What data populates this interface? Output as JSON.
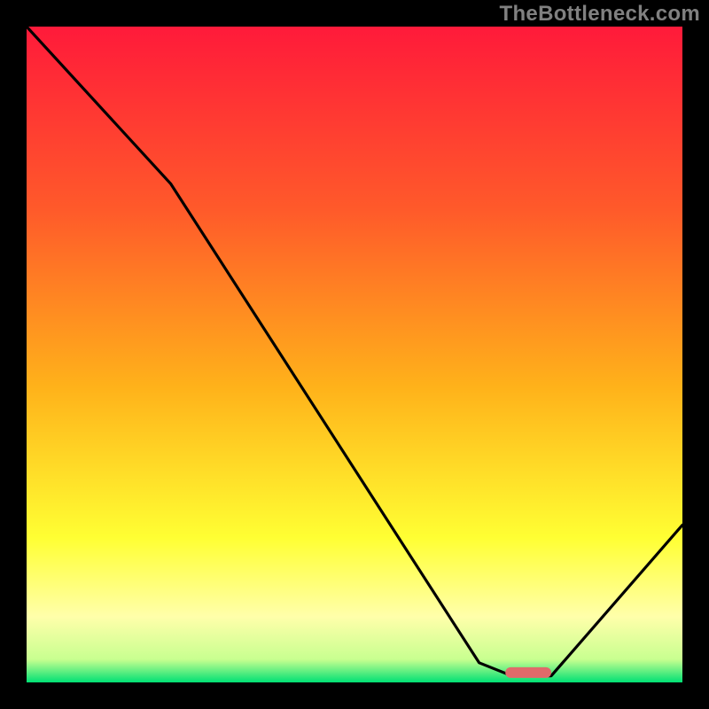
{
  "watermark": "TheBottleneck.com",
  "colors": {
    "frame": "#000000",
    "red": "#ff1a3a",
    "orange": "#ff9a1a",
    "yellow": "#ffff33",
    "paleyellow": "#ffffaa",
    "green": "#00e074",
    "curve": "#000000",
    "marker": "#e06a6a",
    "watermark": "#808080"
  },
  "chart_data": {
    "type": "line",
    "title": "",
    "xlabel": "",
    "ylabel": "",
    "xlim": [
      0,
      100
    ],
    "ylim": [
      0,
      100
    ],
    "curve": {
      "x": [
        0,
        22,
        69,
        74,
        80,
        100
      ],
      "y": [
        100,
        76,
        3,
        1,
        1,
        24
      ]
    },
    "marker": {
      "x_start": 73,
      "x_end": 80,
      "y": 1.5
    },
    "gradient_stops": [
      {
        "offset": 0.0,
        "color": "#ff1a3a"
      },
      {
        "offset": 0.28,
        "color": "#ff5a2a"
      },
      {
        "offset": 0.55,
        "color": "#ffb21a"
      },
      {
        "offset": 0.78,
        "color": "#ffff33"
      },
      {
        "offset": 0.9,
        "color": "#ffffaa"
      },
      {
        "offset": 0.965,
        "color": "#c8ff90"
      },
      {
        "offset": 1.0,
        "color": "#00e074"
      }
    ]
  }
}
